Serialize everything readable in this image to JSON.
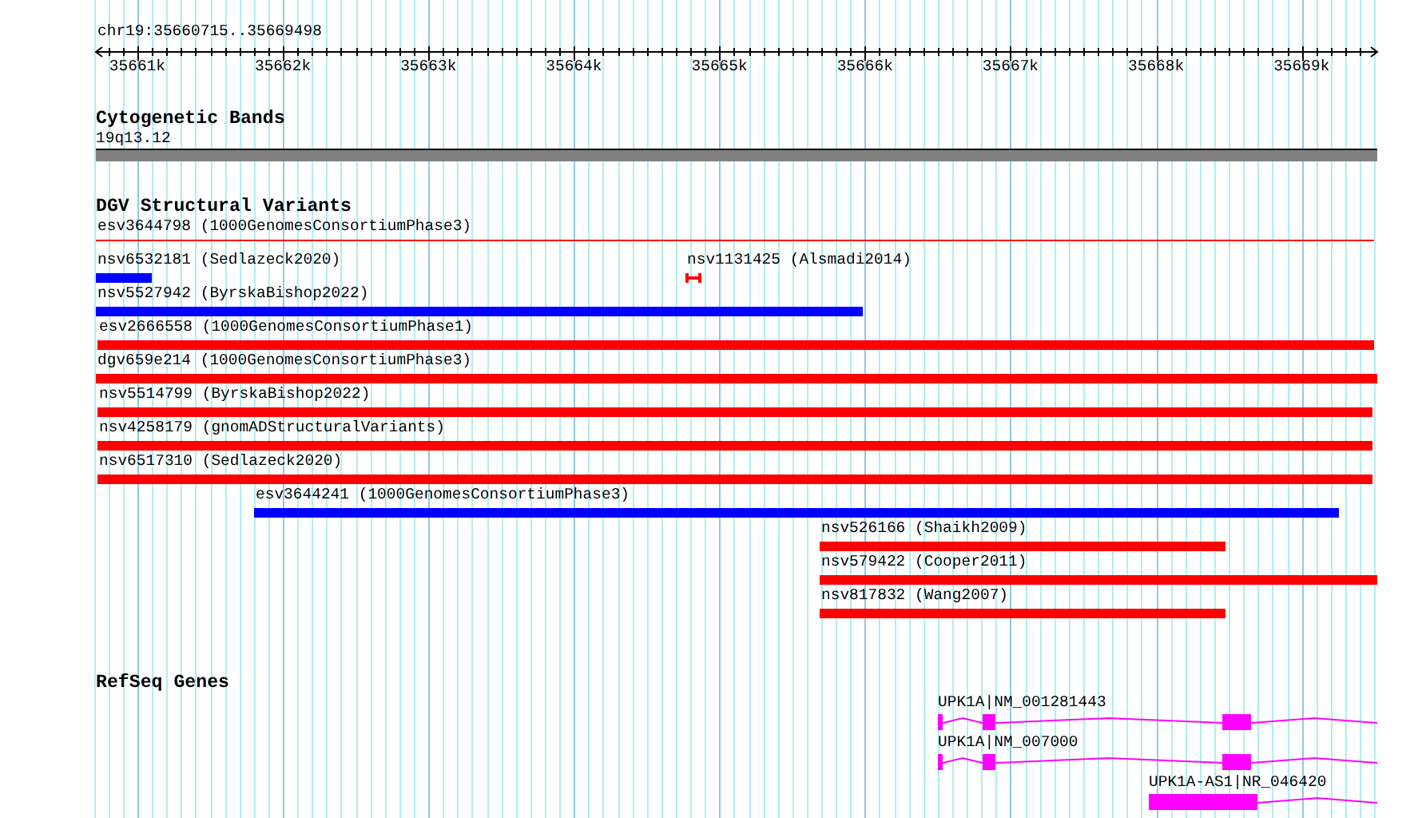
{
  "region_label": "chr19:35660715..35669498",
  "ruler": {
    "ticks": [
      "35661k",
      "35662k",
      "35663k",
      "35664k",
      "35665k",
      "35666k",
      "35667k",
      "35668k",
      "35669k"
    ]
  },
  "tracks": [
    {
      "kind": "bands",
      "title": "Cytogenetic Bands",
      "bands": [
        {
          "label": "19q13.12"
        }
      ]
    },
    {
      "kind": "variants",
      "title": "DGV Structural Variants",
      "rows": [
        {
          "features": [
            {
              "label": "esv3644798 (1000GenomesConsortiumPhase3)",
              "kind": "line",
              "color": "#ff0000"
            }
          ]
        },
        {
          "features": [
            {
              "label": "nsv6532181 (Sedlazeck2020)",
              "kind": "bar",
              "color": "#0000ff"
            },
            {
              "label": "nsv1131425 (Alsmadi2014)",
              "kind": "capped",
              "color": "#ff0000"
            }
          ]
        },
        {
          "features": [
            {
              "label": "nsv5527942 (ByrskaBishop2022)",
              "kind": "bar",
              "color": "#0000ff"
            }
          ]
        },
        {
          "features": [
            {
              "label": "esv2666558 (1000GenomesConsortiumPhase1)",
              "kind": "bar",
              "color": "#ff0000"
            }
          ]
        },
        {
          "features": [
            {
              "label": "dgv659e214 (1000GenomesConsortiumPhase3)",
              "kind": "bar",
              "color": "#ff0000"
            }
          ]
        },
        {
          "features": [
            {
              "label": "nsv5514799 (ByrskaBishop2022)",
              "kind": "bar",
              "color": "#ff0000"
            }
          ]
        },
        {
          "features": [
            {
              "label": "nsv4258179 (gnomADStructuralVariants)",
              "kind": "bar",
              "color": "#ff0000"
            }
          ]
        },
        {
          "features": [
            {
              "label": "nsv6517310 (Sedlazeck2020)",
              "kind": "bar",
              "color": "#ff0000"
            }
          ]
        },
        {
          "features": [
            {
              "label": "esv3644241 (1000GenomesConsortiumPhase3)",
              "kind": "bar",
              "color": "#0000ff"
            }
          ]
        },
        {
          "features": [
            {
              "label": "nsv526166 (Shaikh2009)",
              "kind": "bar",
              "color": "#ff0000"
            }
          ]
        },
        {
          "features": [
            {
              "label": "nsv579422 (Cooper2011)",
              "kind": "bar",
              "color": "#ff0000"
            }
          ]
        },
        {
          "features": [
            {
              "label": "nsv817832 (Wang2007)",
              "kind": "bar",
              "color": "#ff0000"
            }
          ]
        }
      ]
    },
    {
      "kind": "genes",
      "title": "RefSeq Genes",
      "rows": [
        {
          "label": "UPK1A|NM_001281443"
        },
        {
          "label": "UPK1A|NM_007000"
        },
        {
          "label": "UPK1A-AS1|NR_046420"
        }
      ]
    }
  ]
}
